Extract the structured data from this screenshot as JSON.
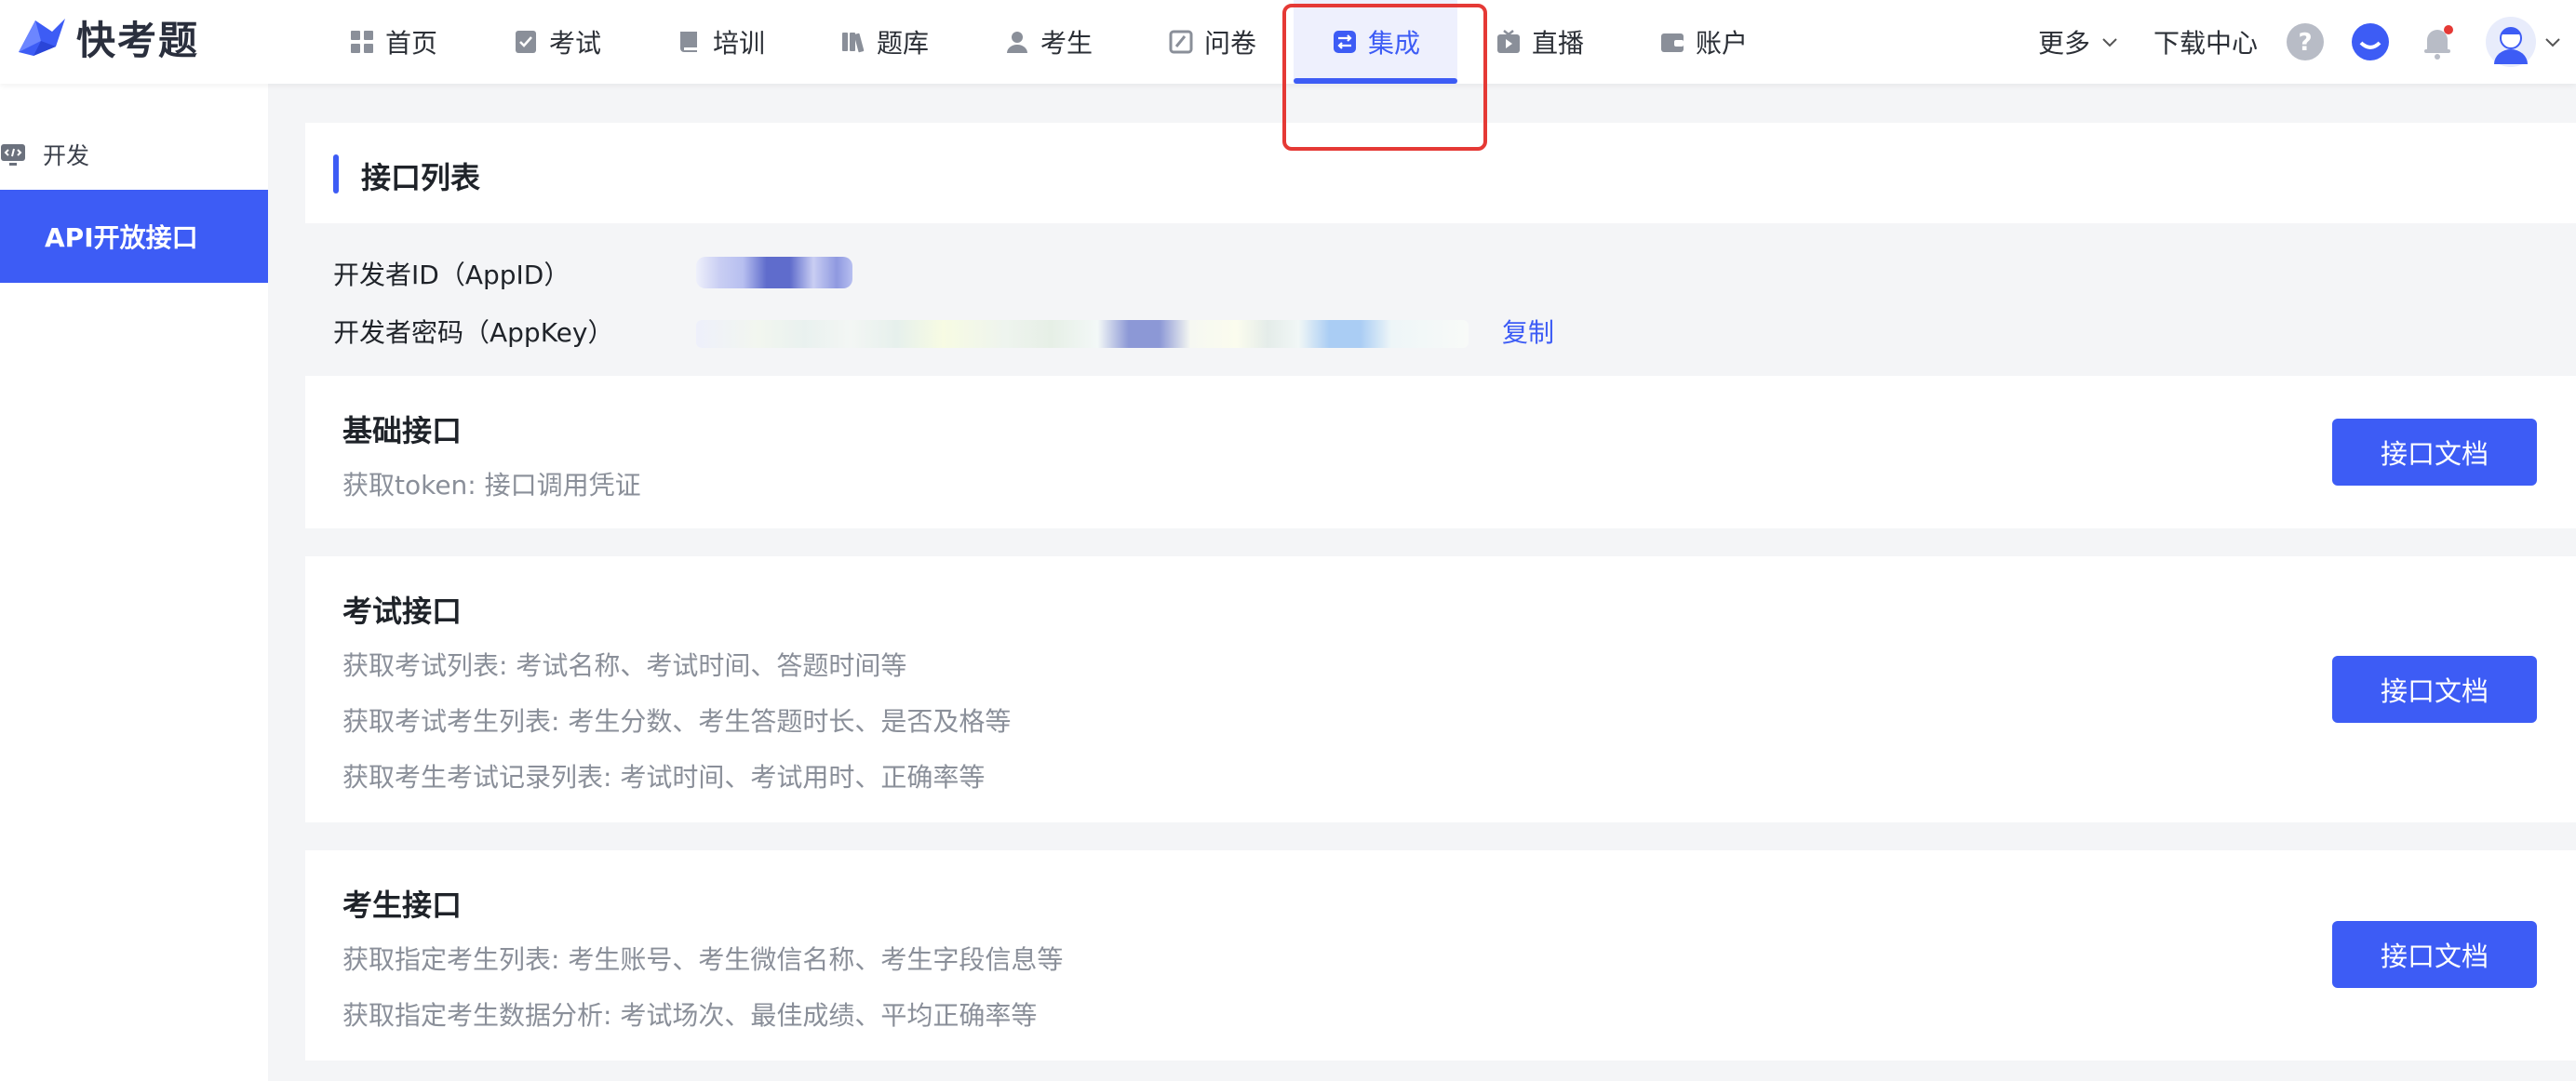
{
  "app": {
    "logo_text": "快考题"
  },
  "nav": {
    "items": [
      {
        "label": "首页",
        "icon": "grid-icon"
      },
      {
        "label": "考试",
        "icon": "exam-icon"
      },
      {
        "label": "培训",
        "icon": "book-icon"
      },
      {
        "label": "题库",
        "icon": "library-icon"
      },
      {
        "label": "考生",
        "icon": "user-icon"
      },
      {
        "label": "问卷",
        "icon": "survey-icon"
      },
      {
        "label": "集成",
        "icon": "integration-icon",
        "active": true
      },
      {
        "label": "直播",
        "icon": "live-icon"
      },
      {
        "label": "账户",
        "icon": "wallet-icon"
      }
    ],
    "more_label": "更多",
    "download_label": "下载中心"
  },
  "sidebar": {
    "group_label": "开发",
    "active_item": "API开放接口"
  },
  "main": {
    "section_title": "接口列表",
    "appid_label": "开发者ID（AppID）",
    "appkey_label": "开发者密码（AppKey）",
    "copy_label": "复制",
    "cards": [
      {
        "title": "基础接口",
        "lines": [
          "获取token: 接口调用凭证"
        ],
        "button": "接口文档"
      },
      {
        "title": "考试接口",
        "lines": [
          "获取考试列表: 考试名称、考试时间、答题时间等",
          "获取考试考生列表: 考生分数、考生答题时长、是否及格等",
          "获取考生考试记录列表: 考试时间、考试用时、正确率等"
        ],
        "button": "接口文档"
      },
      {
        "title": "考生接口",
        "lines": [
          "获取指定考生列表: 考生账号、考生微信名称、考生字段信息等",
          "获取指定考生数据分析: 考试场次、最佳成绩、平均正确率等"
        ],
        "button": "接口文档"
      }
    ]
  },
  "colors": {
    "accent": "#3d5cf5",
    "highlight": "#e53935",
    "muted_text": "#8a8f99"
  }
}
